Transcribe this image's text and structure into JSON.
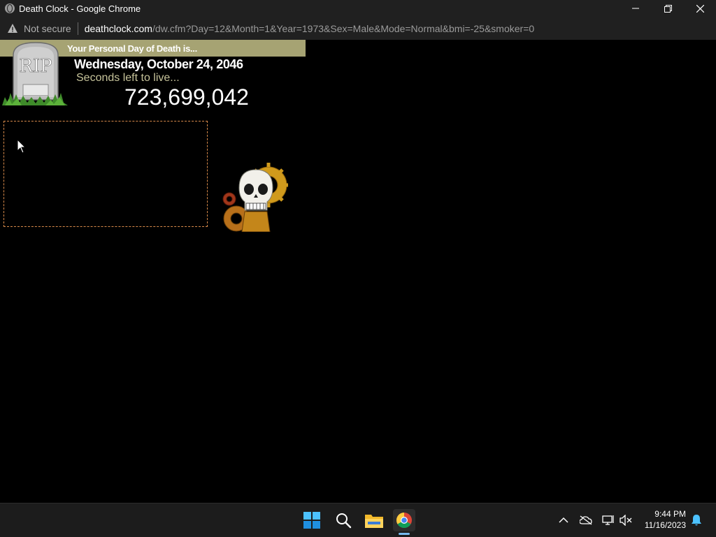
{
  "window": {
    "title": "Death Clock - Google Chrome",
    "controls": {
      "minimize": "minimize",
      "restore": "restore",
      "close": "close"
    }
  },
  "addressbar": {
    "security_label": "Not secure",
    "url_domain": "deathclock.com",
    "url_path": "/dw.cfm?Day=12&Month=1&Year=1973&Sex=Male&Mode=Normal&bmi=-25&smoker=0"
  },
  "page": {
    "banner_text": "Your Personal Day of Death is...",
    "tombstone_text": "RIP",
    "death_date": "Wednesday, October 24, 2046",
    "seconds_label": "Seconds left to live...",
    "seconds_count": "723,699,042",
    "colors": {
      "banner": "#a6a373",
      "seconds_label": "#c6c39a",
      "ad_border": "#d88a4a"
    }
  },
  "taskbar": {
    "apps": [
      "start-icon",
      "search-icon",
      "file-explorer-icon",
      "chrome-icon"
    ],
    "tray": [
      "chevron-up-icon",
      "onedrive-icon",
      "network-icon",
      "volume-muted-icon",
      "notification-bell-icon"
    ],
    "time": "9:44 PM",
    "date": "11/16/2023"
  }
}
